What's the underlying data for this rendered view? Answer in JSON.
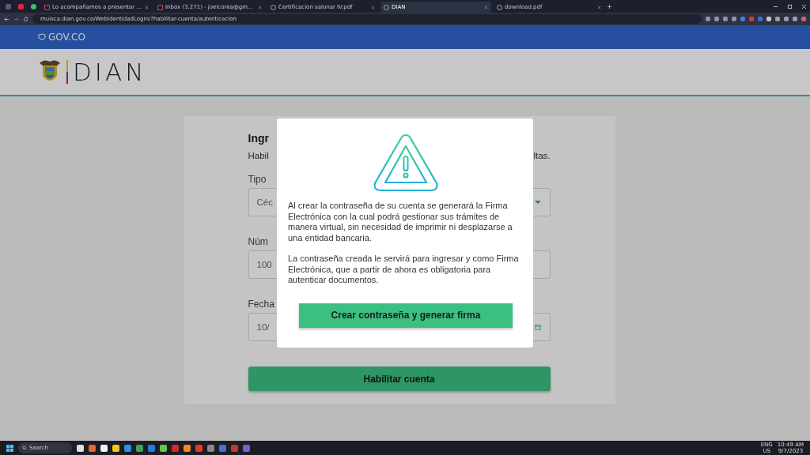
{
  "browser": {
    "tabs": [
      {
        "title": "Lo acompañamos a presentar ...",
        "selected": false
      },
      {
        "title": "Inbox (3,271) - joelcorea@gm...",
        "selected": false
      },
      {
        "title": "Certificacion salonar IV.pdf",
        "selected": false
      },
      {
        "title": "DIAN",
        "selected": true
      },
      {
        "title": "download.pdf",
        "selected": false
      }
    ],
    "url": "muisca.dian.gov.co/WebIdentidadLogin/?habilitar-cuenta/autenticacion"
  },
  "gov_bar": {
    "label": "GOV.CO"
  },
  "header": {
    "brand": "DIAN"
  },
  "form": {
    "title": "Ingr",
    "subtitle_left": "Habil",
    "subtitle_right": "ltas.",
    "fields": [
      {
        "label": "Tipo",
        "value": "Céc",
        "kind": "select"
      },
      {
        "label": "Núm",
        "value": "100",
        "kind": "text"
      },
      {
        "label": "Fecha",
        "value": "10/",
        "kind": "date"
      }
    ],
    "submit": "Habilitar cuenta"
  },
  "modal": {
    "paragraphs": [
      "Al crear la contraseña de su cuenta se generará la Firma Electrónica con la cual podrá gestionar sus trámites de manera virtual, sin necesidad de imprimir ni desplazarse a una entidad bancaria.",
      "La contraseña creada le servirá para ingresar y como Firma Electrónica, que a partir de ahora es obligatoria para autenticar documentos."
    ],
    "button": "Crear contraseña y generar firma"
  },
  "taskbar": {
    "search": "Search",
    "language": "ENG",
    "region": "US",
    "time": "10:49 AM",
    "date": "9/7/2023"
  }
}
